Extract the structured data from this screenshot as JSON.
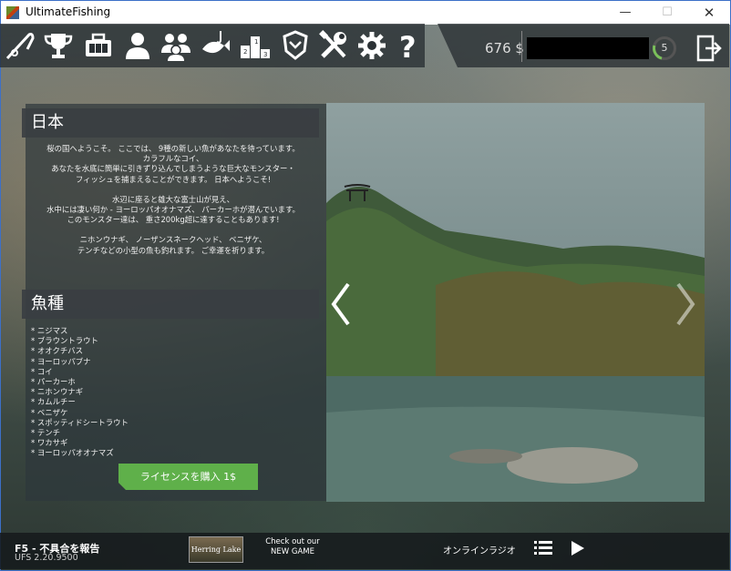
{
  "window": {
    "title": "UltimateFishing",
    "minimize": "—",
    "maximize": "☐",
    "close": "✕"
  },
  "toolbar": {
    "icons": [
      "fishing-rod-icon",
      "trophy-icon",
      "tackle-box-icon",
      "profile-icon",
      "multiplayer-icon",
      "hooked-fish-icon",
      "leaderboard-icon",
      "shield-badge-icon",
      "tools-icon",
      "gear-icon",
      "help-icon"
    ],
    "money": "676 $",
    "level": "5"
  },
  "panel": {
    "title": "日本",
    "description": [
      "桜の国へようこそ。 ここでは、 9種の新しい魚があなたを待っています。\nカラフルなコイ、\nあなたを水底に簡単に引きずり込んでしまうような巨大なモンスター・\nフィッシュを捕まえることができます。 日本へようこそ!",
      "水辺に座ると雄大な富士山が見え、\n水中には凄い何か - ヨーロッパオオナマズ、 パーカーホが潜んでいます。\nこのモンスター達は、 重さ200kg超に達することもあります!",
      "ニホンウナギ、 ノーザンスネークヘッド、 ベニザケ、\nテンチなどの小型の魚も釣れます。 ご幸運を祈ります。"
    ],
    "species_title": "魚種",
    "species": [
      "ニジマス",
      "ブラウントラウト",
      "オオクチバス",
      "ヨーロッパブナ",
      "コイ",
      "パーカーホ",
      "ニホンウナギ",
      "カムルチー",
      "ベニザケ",
      "スポッティドシートラウト",
      "テンチ",
      "ワカサギ",
      "ヨーロッパオオナマズ"
    ],
    "buy_label": "ライセンスを購入 1$"
  },
  "footer": {
    "report": "F5 - 不具合を報告",
    "version": "UFS 2.20.9500",
    "ad_image_text": "Herring Lake",
    "checkout": "Check out our\nNEW GAME",
    "radio": "オンラインラジオ"
  },
  "colors": {
    "accent_green": "#5fb04a",
    "level_ring": "#7ac05a",
    "titlebar_border": "#3c70c8"
  }
}
